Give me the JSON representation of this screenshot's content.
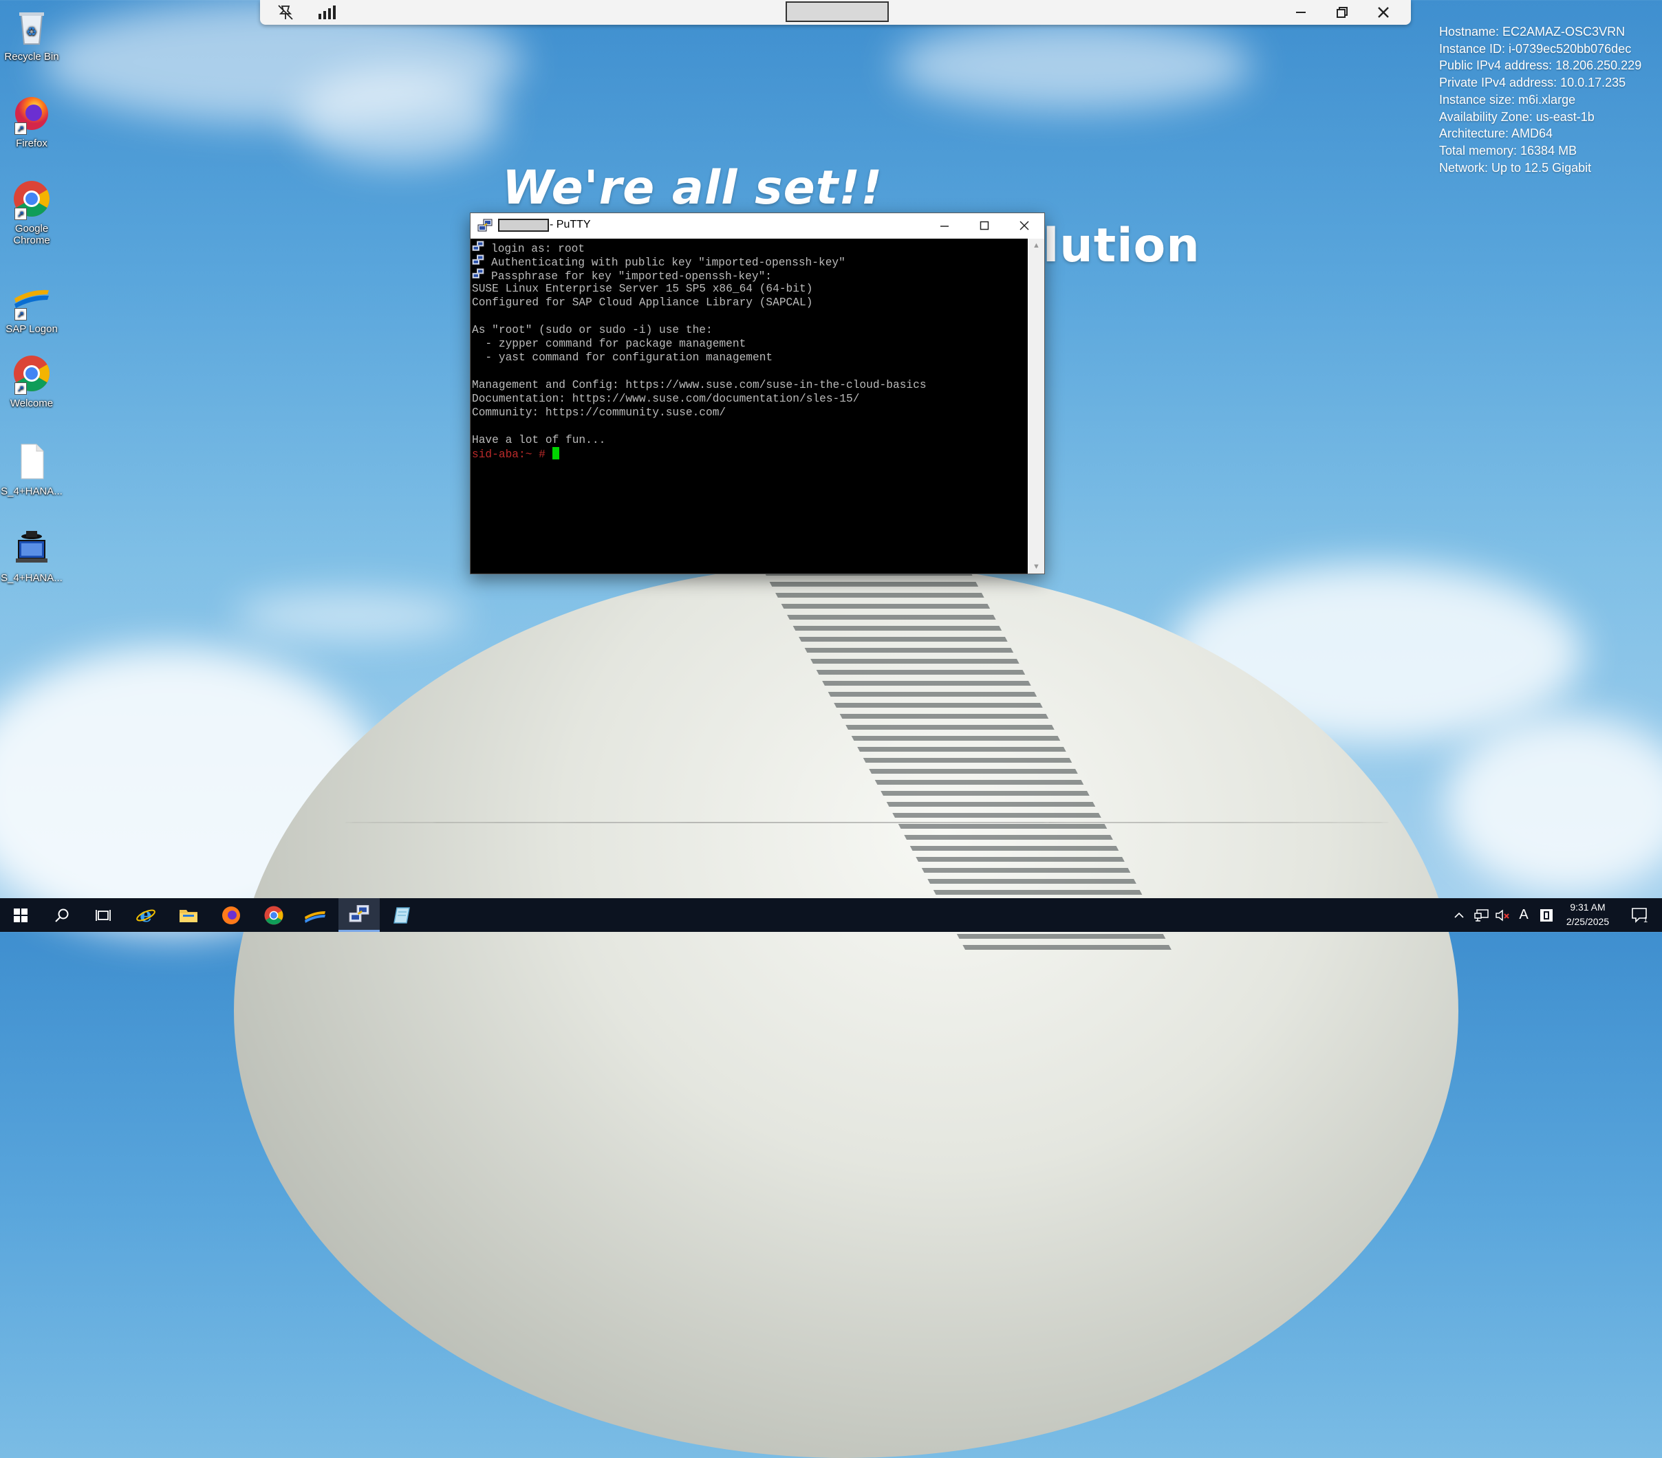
{
  "desktop": {
    "icons": [
      {
        "label": "Recycle Bin",
        "icon": "recycle-bin-icon"
      },
      {
        "label": "Firefox",
        "icon": "firefox-icon"
      },
      {
        "label": "Google Chrome",
        "icon": "chrome-icon"
      },
      {
        "label": "SAP Logon",
        "icon": "sap-logon-icon"
      },
      {
        "label": "Welcome",
        "icon": "chrome-icon"
      },
      {
        "label": "S_4+HANA...",
        "icon": "document-icon"
      },
      {
        "label": "S_4+HANA...",
        "icon": "sap-gui-icon"
      }
    ],
    "wallpaper_text": {
      "line1": "We're all set!!",
      "line2": "lution"
    }
  },
  "sysinfo": [
    "Hostname: EC2AMAZ-OSC3VRN",
    "Instance ID: i-0739ec520bb076dec",
    "Public IPv4 address: 18.206.250.229",
    "Private IPv4 address: 10.0.17.235",
    "Instance size: m6i.xlarge",
    "Availability Zone: us-east-1b",
    "Architecture: AMD64",
    "Total memory: 16384 MB",
    "Network: Up to 12.5 Gigabit"
  ],
  "rdp_bar": {
    "icons": [
      "pin-icon",
      "signal-strength-icon",
      "minimize-icon",
      "restore-icon",
      "close-icon"
    ]
  },
  "putty": {
    "title": "- PuTTY",
    "terminal": {
      "lines": [
        {
          "icon": true,
          "text": "login as: root"
        },
        {
          "icon": true,
          "text": "Authenticating with public key \"imported-openssh-key\""
        },
        {
          "icon": true,
          "text": "Passphrase for key \"imported-openssh-key\":"
        },
        {
          "icon": false,
          "text": "SUSE Linux Enterprise Server 15 SP5 x86_64 (64-bit)"
        },
        {
          "icon": false,
          "text": "Configured for SAP Cloud Appliance Library (SAPCAL)"
        },
        {
          "icon": false,
          "text": ""
        },
        {
          "icon": false,
          "text": "As \"root\" (sudo or sudo -i) use the:"
        },
        {
          "icon": false,
          "text": "  - zypper command for package management"
        },
        {
          "icon": false,
          "text": "  - yast command for configuration management"
        },
        {
          "icon": false,
          "text": ""
        },
        {
          "icon": false,
          "text": "Management and Config: https://www.suse.com/suse-in-the-cloud-basics"
        },
        {
          "icon": false,
          "text": "Documentation: https://www.suse.com/documentation/sles-15/"
        },
        {
          "icon": false,
          "text": "Community: https://community.suse.com/"
        },
        {
          "icon": false,
          "text": ""
        },
        {
          "icon": false,
          "text": "Have a lot of fun..."
        }
      ],
      "prompt": "sid-aba:~ # "
    }
  },
  "taskbar": {
    "items": [
      {
        "name": "start-button",
        "icon": "windows-icon"
      },
      {
        "name": "search-button",
        "icon": "search-icon"
      },
      {
        "name": "task-view-button",
        "icon": "task-view-icon"
      },
      {
        "name": "taskbar-internet-explorer",
        "icon": "internet-explorer-icon"
      },
      {
        "name": "taskbar-file-explorer",
        "icon": "folder-icon"
      },
      {
        "name": "taskbar-firefox",
        "icon": "firefox-icon"
      },
      {
        "name": "taskbar-chrome",
        "icon": "chrome-icon"
      },
      {
        "name": "taskbar-sap-logon",
        "icon": "sap-logon-icon"
      },
      {
        "name": "taskbar-putty",
        "icon": "putty-icon"
      },
      {
        "name": "taskbar-hana-studio",
        "icon": "notepad-icon"
      }
    ],
    "tray_icons": [
      "chevron-up-icon",
      "network-icon",
      "volume-muted-icon",
      "input-language-icon",
      "ime-icon"
    ],
    "ime_label": "A",
    "clock": {
      "time": "9:31 AM",
      "date": "2/25/2025"
    },
    "notification_count": "1"
  }
}
